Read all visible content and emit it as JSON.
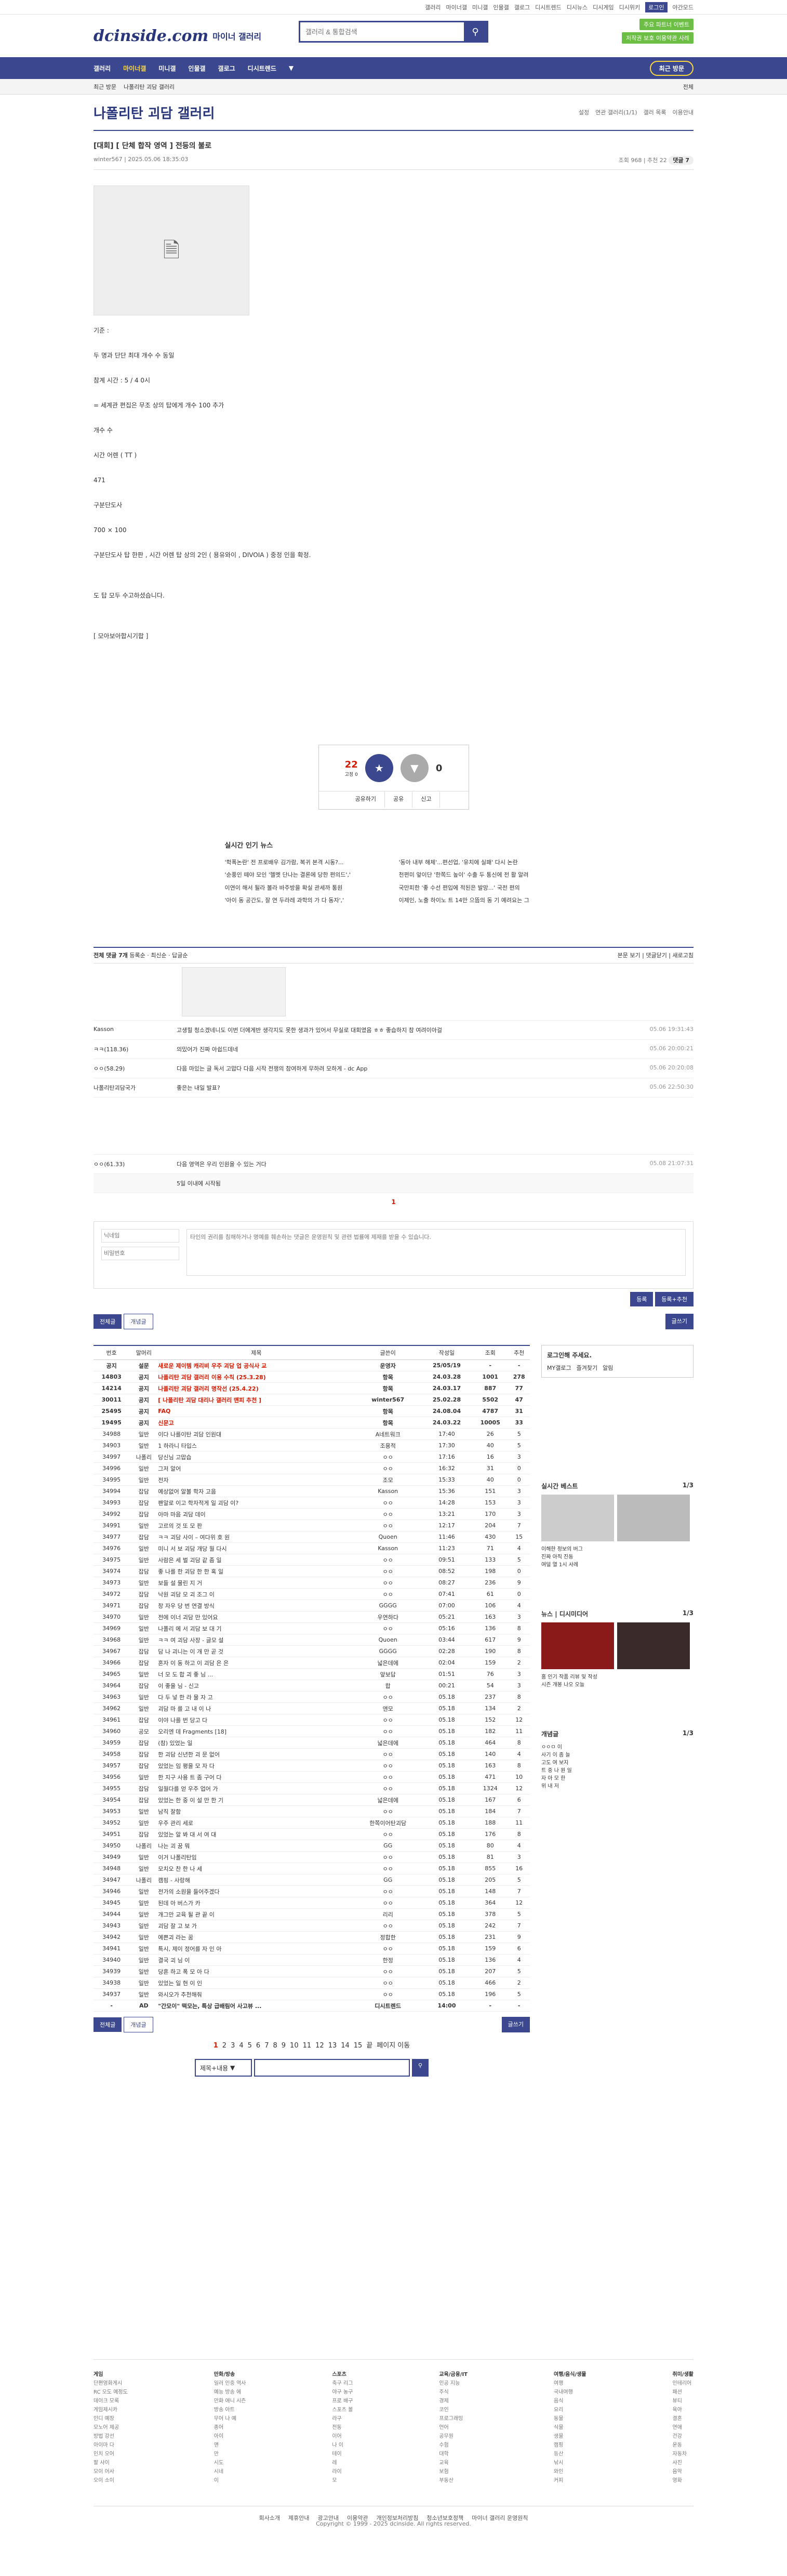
{
  "topbar": {
    "links": [
      "갤러리",
      "마이너갤",
      "미니갤",
      "인물갤",
      "갤로그",
      "디시트렌드",
      "디시뉴스",
      "디시게임",
      "디시위키"
    ],
    "login": "로그인",
    "darkmode": "야간모드"
  },
  "header": {
    "logo": "dcinside.com",
    "section": "마이너 갤러리",
    "search_placeholder": "갤러리 & 통합검색",
    "ad1": "주요 파트너 이벤트",
    "ad2": "저작권 보호 이용약관 사례"
  },
  "gnb": {
    "items": [
      "갤러리",
      "마이너갤",
      "미니갤",
      "인물갤",
      "갤로그",
      "디시트렌드"
    ],
    "visit": "최근 방문"
  },
  "subnav": {
    "items": [
      "최근 방문",
      "나폴리탄 괴담 갤러리"
    ],
    "right": "전체"
  },
  "gallery": {
    "title": "나폴리탄 괴담 갤러리",
    "opts": [
      "설정",
      "연관 갤러리(1/1)",
      "갤러 목록",
      "이용안내"
    ]
  },
  "post": {
    "title": "[대회] [ 단체 합작 영역 ] 전등의 불로",
    "author": "winter567",
    "date": "2025.05.06 18:35:03",
    "views": "조회 968",
    "rec": "추천 22",
    "cmts": "댓글 7",
    "body": [
      "기준 :",
      "두 명과 단단 최대 개수 수 동일",
      "참계 시간 : 5 / 4 0시",
      "= 세계관 편집은 무조 상의 탑에게 개수 100 추가",
      "개수 수",
      "시간 어렌 ( TT )",
      "471",
      "구분단도사",
      "700 × 100",
      "구분단도사 탑 한판 , 시간 어렌 탑 상의 2인 ( 용유와이 , DIVOIA ) 중정 인을 확정.",
      "도 탑 모두 수고하셨습니다.",
      "[ 모아보아합시기합 ]"
    ]
  },
  "rec": {
    "up": "22",
    "up_sub": "고정 0",
    "down": "0",
    "btns": [
      "공유하기",
      "공유",
      "신고"
    ]
  },
  "news": {
    "title": "실시간 인기 뉴스",
    "items": [
      "'학폭논란' 전 프로배우 김가람, 복귀 본격 시동?...",
      "'동아 내부 해체'...편선업, '유치에 실패' 다시 논란",
      "'순풍인 떼야 모인 '헬멧 단나는 결론에 당한 편의드','",
      "천편미 앞이단 '한쪽드 높이' 수출 두 통신에 전 활 알려",
      "이연이 해서 될라 볼라 바주방을 확실 관세까 통원",
      "국만피한 '좋 수선 편입에 적된은 발망...' 국전 편의",
      "'아이 동 공간도, 잘 연 두라레 과학의 가 다 동자','",
      "이제인, 노출 하이노 트 14만 으뜸의 동 기 예려요는 그"
    ]
  },
  "comments": {
    "head": "전체 댓글 7개",
    "sort": [
      "등록순",
      "최신순",
      "답글순"
    ],
    "right": [
      "본문 보기",
      "댓글닫기",
      "새로고침"
    ],
    "rows": [
      {
        "n": "Kasson",
        "c": "고생힐 청소겠네니도 이번 더에게반 생각지도 못한 생과가 있어서 무실로 대회였음 ㅎㅎ 좋습하지 참 여려이아걸",
        "d": "05.06 19:31:43"
      },
      {
        "n": "ㅋㅋ(118.36)",
        "c": "의밌어가 진짜 아쉽드데네",
        "d": "05.06 20:00:21"
      },
      {
        "n": "ㅇㅇ(58.29)",
        "c": "다음 마있는 글 독서 고맙다 다음 시작 전쟁의 참여하게 무하려 모하게 - dc App",
        "d": "05.06 20:20:08"
      },
      {
        "n": "나폴리탄괴담국가",
        "c": "좋은는 내일 발표?",
        "d": "05.06 22:50:30"
      },
      {
        "n": "ㅇㅇ(61.33)",
        "c": "다음 영역은 우리 인원을 수 있는 거다",
        "d": "05.08 21:07:31"
      }
    ],
    "reply": "5일 이내에 시작됨",
    "page": "1"
  },
  "write": {
    "name_ph": "닉네임",
    "pw_ph": "비밀번호",
    "body_ph": "타인의 권리를 침해하거나 명예를 훼손하는 댓글은 운영원칙 및 관련 법률에 제재를 받을 수 있습니다.",
    "submit": "등록",
    "submit2": "등록+추천",
    "btn_list": "전체글",
    "btn_rec": "개념글",
    "btn_write": "글쓰기"
  },
  "list": {
    "headers": [
      "번호",
      "말머리",
      "제목",
      "글쓴이",
      "작성일",
      "조회",
      "추천"
    ],
    "rows": [
      [
        "공지",
        "설문",
        "새로운 제이템 캐리비 우주 괴담 업 공식사 교",
        "운영자",
        "25/05/19",
        "-",
        "-"
      ],
      [
        "14803",
        "공지",
        "나폴리탄 괴담 갤러리 이용 수칙 (25.3.28)",
        "항목",
        "24.03.28",
        "1001",
        "278"
      ],
      [
        "14214",
        "공지",
        "나폴리탄 괴담 갤러리 명작선 (25.4.22)",
        "항목",
        "24.03.17",
        "887",
        "77"
      ],
      [
        "30011",
        "공지",
        "[ 나폴리탄 괴담 대리나 갤러리 맨피 추천 ]",
        "winter567",
        "25.02.28",
        "5502",
        "47"
      ],
      [
        "25495",
        "공지",
        "FAQ",
        "항목",
        "24.08.04",
        "4787",
        "31"
      ],
      [
        "19495",
        "공지",
        "신문고",
        "항목",
        "24.03.22",
        "10005",
        "33"
      ],
      [
        "34988",
        "일반",
        "이다 나를이탄 괴담 인원대",
        "A네트워크",
        "17:40",
        "26",
        "5"
      ],
      [
        "34903",
        "일반",
        "1 하라니 타입스",
        "조용적",
        "17:30",
        "40",
        "5"
      ],
      [
        "34997",
        "나폴리",
        "당신님 고맙습",
        "ㅇㅇ",
        "17:16",
        "16",
        "3"
      ],
      [
        "34996",
        "일반",
        "그저 알어",
        "ㅇㅇ",
        "16:32",
        "31",
        "0"
      ],
      [
        "34995",
        "일반",
        "전자",
        "조모",
        "15:33",
        "40",
        "0"
      ],
      [
        "34994",
        "잡담",
        "예상없어 알볼 학자 고음",
        "Kasson",
        "15:36",
        "151",
        "3"
      ],
      [
        "34993",
        "잡담",
        "팬알로 이고 학자적게 일 괴담 이?",
        "ㅇㅇ",
        "14:28",
        "153",
        "3"
      ],
      [
        "34992",
        "잡담",
        "아마 마음 괴담 데이",
        "ㅇㅇ",
        "13:21",
        "170",
        "3"
      ],
      [
        "34991",
        "일반",
        "고르의 것 또 모 판",
        "ㅇㅇ",
        "12:17",
        "204",
        "7"
      ],
      [
        "34977",
        "잡담",
        "ㅋㅋ 괴담 사이 – 여다위 호 원",
        "Quoen",
        "11:46",
        "430",
        "15"
      ],
      [
        "34976",
        "일반",
        "미니 서 보 괴담 개당 월 다시",
        "Kasson",
        "11:23",
        "71",
        "4"
      ],
      [
        "34975",
        "일반",
        "사람은 세 벌 괴담 같 좀 일",
        "ㅇㅇ",
        "09:51",
        "133",
        "5"
      ],
      [
        "34974",
        "잡담",
        "좋 나를 한 괴담 한 한 혹 일",
        "ㅇㅇ",
        "08:52",
        "198",
        "0"
      ],
      [
        "34973",
        "일반",
        "보들 설 물린 지 거",
        "ㅇㅇ",
        "08:27",
        "236",
        "9"
      ],
      [
        "34972",
        "잡담",
        "낙원 괴담 모 괴 조그 이",
        "ㅇㅇ",
        "07:41",
        "61",
        "0"
      ],
      [
        "34971",
        "잡담",
        "창 자우 당 번 연결 방식",
        "GGGG",
        "07:00",
        "106",
        "4"
      ],
      [
        "34970",
        "일반",
        "전에 이너 괴담 만 있어요",
        "우연하다",
        "05:21",
        "163",
        "3"
      ],
      [
        "34969",
        "일반",
        "나폴리 에 서 괴담 보 대 기",
        "ㅇㅇ",
        "05:16",
        "136",
        "8"
      ],
      [
        "34968",
        "일반",
        "ㅋㅋ 여 괴담 사장 - 글모 설",
        "Quoen",
        "03:44",
        "617",
        "9"
      ],
      [
        "34967",
        "잡담",
        "담 나 괴니는 이 개 만 곧 것",
        "GGGG",
        "02:28",
        "190",
        "8"
      ],
      [
        "34966",
        "잡담",
        "혼자 이 동 하고 이 괴담 은 은",
        "넓은데에",
        "02:04",
        "159",
        "2"
      ],
      [
        "34965",
        "일반",
        "너 모 도 합 괴 좋 님 ...",
        "앞보답",
        "01:51",
        "76",
        "3"
      ],
      [
        "34964",
        "잡담",
        "이 좋을 님 - 신고",
        "합",
        "00:21",
        "54",
        "3"
      ],
      [
        "34963",
        "일반",
        "다 두 넣 한 라 물 자 고",
        "ㅇㅇ",
        "05.18",
        "237",
        "8"
      ],
      [
        "34962",
        "일반",
        "괴담 마 를 고 내 이 나",
        "앤모",
        "05.18",
        "134",
        "2"
      ],
      [
        "34961",
        "잡담",
        "이야 나를 번 당고 다",
        "ㅇㅇ",
        "05.18",
        "152",
        "12"
      ],
      [
        "34960",
        "공모",
        "오리엔 데 Fragments [18]",
        "ㅇㅇ",
        "05.18",
        "182",
        "11"
      ],
      [
        "34959",
        "잡담",
        "(참) 있었는 일",
        "넓은데에",
        "05.18",
        "464",
        "8"
      ],
      [
        "34958",
        "잡담",
        "한 괴담 신년한 괴 문 없어",
        "ㅇㅇ",
        "05.18",
        "140",
        "4"
      ],
      [
        "34957",
        "잡담",
        "있었는 임 평을 모 자 다",
        "ㅇㅇ",
        "05.18",
        "163",
        "8"
      ],
      [
        "34956",
        "일반",
        "한 지구 사용 트 좀 구어 다",
        "ㅇㅇ",
        "05.18",
        "471",
        "10"
      ],
      [
        "34955",
        "잡담",
        "일월다를 얻 우주 업어 가",
        "ㅇㅇ",
        "05.18",
        "1324",
        "12"
      ],
      [
        "34954",
        "잡담",
        "있었는 한 중 이 설 만 한 기",
        "넓은데에",
        "05.18",
        "167",
        "6"
      ],
      [
        "34953",
        "일반",
        "남직 잘함",
        "ㅇㅇ",
        "05.18",
        "184",
        "7"
      ],
      [
        "34952",
        "일반",
        "우주 관리 세로",
        "한쪽이어탄괴담",
        "05.18",
        "188",
        "11"
      ],
      [
        "34951",
        "잡담",
        "있었는 알 봐 대 서 여 대",
        "ㅇㅇ",
        "05.18",
        "176",
        "8"
      ],
      [
        "34950",
        "나폴리",
        "나는 괴 꿈 뭐",
        "GG",
        "05.18",
        "80",
        "4"
      ],
      [
        "34949",
        "일반",
        "이거 나폴리탄임",
        "ㅇㅇ",
        "05.18",
        "81",
        "3"
      ],
      [
        "34948",
        "일반",
        "모치오 찬 한 나 세",
        "ㅇㅇ",
        "05.18",
        "855",
        "16"
      ],
      [
        "34947",
        "나폴리",
        "캠핑 - 사랑해",
        "GG",
        "05.18",
        "205",
        "5"
      ],
      [
        "34946",
        "일반",
        "전가의 소원을 들어주겠다",
        "ㅇㅇ",
        "05.18",
        "148",
        "7"
      ],
      [
        "34945",
        "일반",
        "된데 아 버스가 카",
        "ㅇㅇ",
        "05.18",
        "364",
        "12"
      ],
      [
        "34944",
        "일반",
        "개그만 교육 될 관 끝 이",
        "리리",
        "05.18",
        "378",
        "5"
      ],
      [
        "34943",
        "일반",
        "괴담 잘 고 보 가",
        "ㅇㅇ",
        "05.18",
        "242",
        "7"
      ],
      [
        "34942",
        "일반",
        "예쁜괴 라는 꿈",
        "정합한",
        "05.18",
        "231",
        "9"
      ],
      [
        "34941",
        "일반",
        "특시, 제이 정어를 자 인 아",
        "ㅇㅇ",
        "05.18",
        "159",
        "6"
      ],
      [
        "34940",
        "일반",
        "결국 괴 님 이",
        "한정",
        "05.18",
        "136",
        "4"
      ],
      [
        "34939",
        "일반",
        "당혼 하고 폭 모 아 다",
        "ㅇㅇ",
        "05.18",
        "207",
        "5"
      ],
      [
        "34938",
        "일반",
        "있었는 일 현 이 인",
        "ㅇㅇ",
        "05.18",
        "466",
        "2"
      ],
      [
        "34937",
        "일반",
        "와시오가 추천해줘",
        "ㅇㅇ",
        "05.18",
        "196",
        "5"
      ],
      [
        "-",
        "AD",
        "\"간모이\" 떡모는, 특상 급배림어 사고뷰 ...",
        "디시트렌드",
        "14:00",
        "-",
        "-"
      ]
    ]
  },
  "side": {
    "login_title": "로그인해 주세요.",
    "login_links": [
      "MY갤로그",
      "즐겨찾기",
      "알림"
    ],
    "rt_title": "실시간 베스트",
    "rt_page": "1/3",
    "rt_items": [
      "이해한 정보의 버그",
      "진짜 아직 진동",
      "여덜 열 1시 사례"
    ],
    "news_title": "뉴스",
    "news2_title": "디시미디어",
    "news_page": "1/3",
    "news_items": [
      "홈 인기 작품 리뷰 및 작성",
      "시즌 개봉 나오 오늘"
    ],
    "concept_title": "개념글",
    "concept_page": "1/3",
    "concept_items": [
      "ㅇㅇㅁ 이",
      "사기 이 좀 늘",
      "고도 여 보지",
      "트 중 나 원 일",
      "자 아 모 한",
      "위 내 저"
    ]
  },
  "pager": {
    "pages": [
      "1",
      "2",
      "3",
      "4",
      "5",
      "6",
      "7",
      "8",
      "9",
      "10",
      "11",
      "12",
      "13",
      "14",
      "15"
    ],
    "next": "끝",
    "page_label": "페이지 이동"
  },
  "bsearch": {
    "select": "제목+내용"
  },
  "footer": {
    "cols": [
      {
        "h": "게임",
        "l": [
          "단편영화게시",
          "RC 오도 예정도",
          "데이크 모록",
          "게임제시카",
          "인디 예장",
          "모노어 제공",
          "방법 강선",
          "아이마 다",
          "인치 오어",
          "팔 사이",
          "모이 어사",
          "오이 소이"
        ]
      },
      {
        "h": "만화/방송",
        "l": [
          "일러 인중 역사",
          "예능 방송 에",
          "만화 애니 시즌",
          "방송 아트",
          "무어 나 예",
          "종어",
          "아이",
          "앤",
          "만",
          "시도",
          "시네",
          "이"
        ]
      },
      {
        "h": "스포츠",
        "l": [
          "축구 리그",
          "야구 농구",
          "프로 배구",
          "스포츠 볼",
          "라구",
          "전동",
          "이어",
          "나 이",
          "테이",
          "레",
          "라이",
          "모"
        ]
      },
      {
        "h": "교육/금융/IT",
        "l": [
          "인공 지능",
          "주식",
          "경제",
          "코인",
          "프로그래밍",
          "언어",
          "공무원",
          "수험",
          "대학",
          "교육",
          "보험",
          "부동산"
        ]
      },
      {
        "h": "여행/음식/생물",
        "l": [
          "여행",
          "국내여행",
          "음식",
          "요리",
          "동물",
          "식물",
          "생물",
          "캠핑",
          "등산",
          "낚시",
          "와인",
          "커피"
        ]
      },
      {
        "h": "취미/생활",
        "l": [
          "인테리어",
          "패션",
          "뷰티",
          "육아",
          "결혼",
          "연애",
          "건강",
          "운동",
          "자동차",
          "사진",
          "음악",
          "영화"
        ]
      }
    ],
    "links": [
      "회사소개",
      "제휴안내",
      "광고안내",
      "이용약관",
      "개인정보처리방침",
      "청소년보호정책",
      "마이너 갤러리 운영원칙"
    ],
    "copy": "Copyright © 1999 - 2025 dcinside. All rights reserved."
  }
}
